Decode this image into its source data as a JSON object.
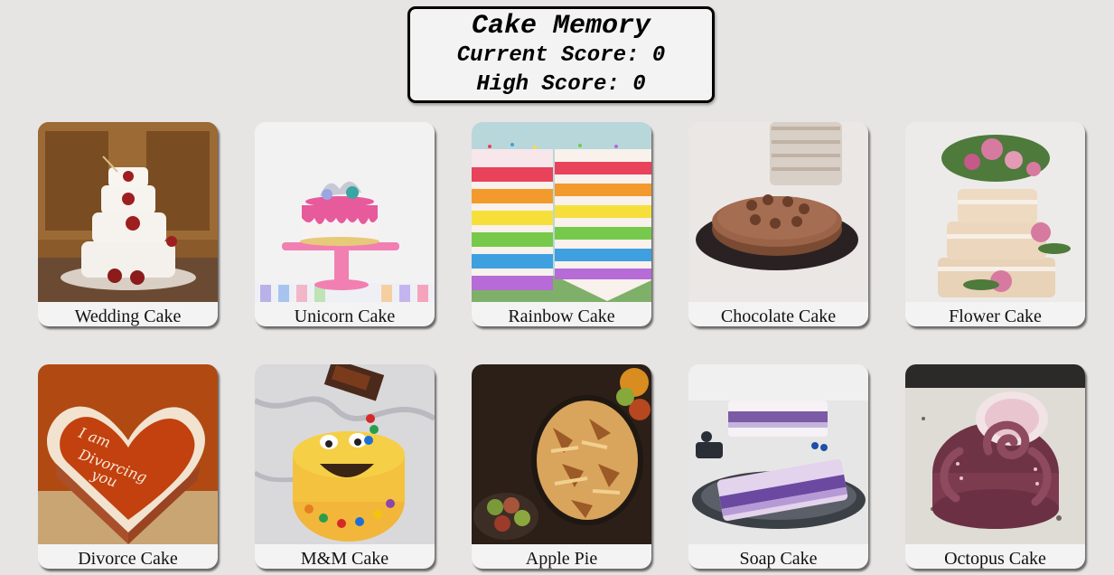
{
  "game": {
    "title": "Cake Memory",
    "current_score_text": "Current Score: 0",
    "high_score_text": "High Score: 0",
    "current_score": 0,
    "high_score": 0
  },
  "cards": [
    {
      "label": "Wedding Cake",
      "image": "wedding-cake-photo"
    },
    {
      "label": "Unicorn Cake",
      "image": "unicorn-cake-photo"
    },
    {
      "label": "Rainbow Cake",
      "image": "rainbow-cake-photo"
    },
    {
      "label": "Chocolate Cake",
      "image": "chocolate-cake-photo"
    },
    {
      "label": "Flower Cake",
      "image": "flower-cake-photo"
    },
    {
      "label": "Divorce Cake",
      "image": "divorce-cake-photo",
      "inscription": "I am Divorcing you"
    },
    {
      "label": "M&M Cake",
      "image": "mm-cake-photo"
    },
    {
      "label": "Apple Pie",
      "image": "apple-pie-photo"
    },
    {
      "label": "Soap Cake",
      "image": "soap-cake-photo"
    },
    {
      "label": "Octopus Cake",
      "image": "octopus-cake-photo"
    }
  ],
  "colors": {
    "background": "#e6e5e4",
    "card": "#f3f3f4",
    "border": "#000000"
  }
}
